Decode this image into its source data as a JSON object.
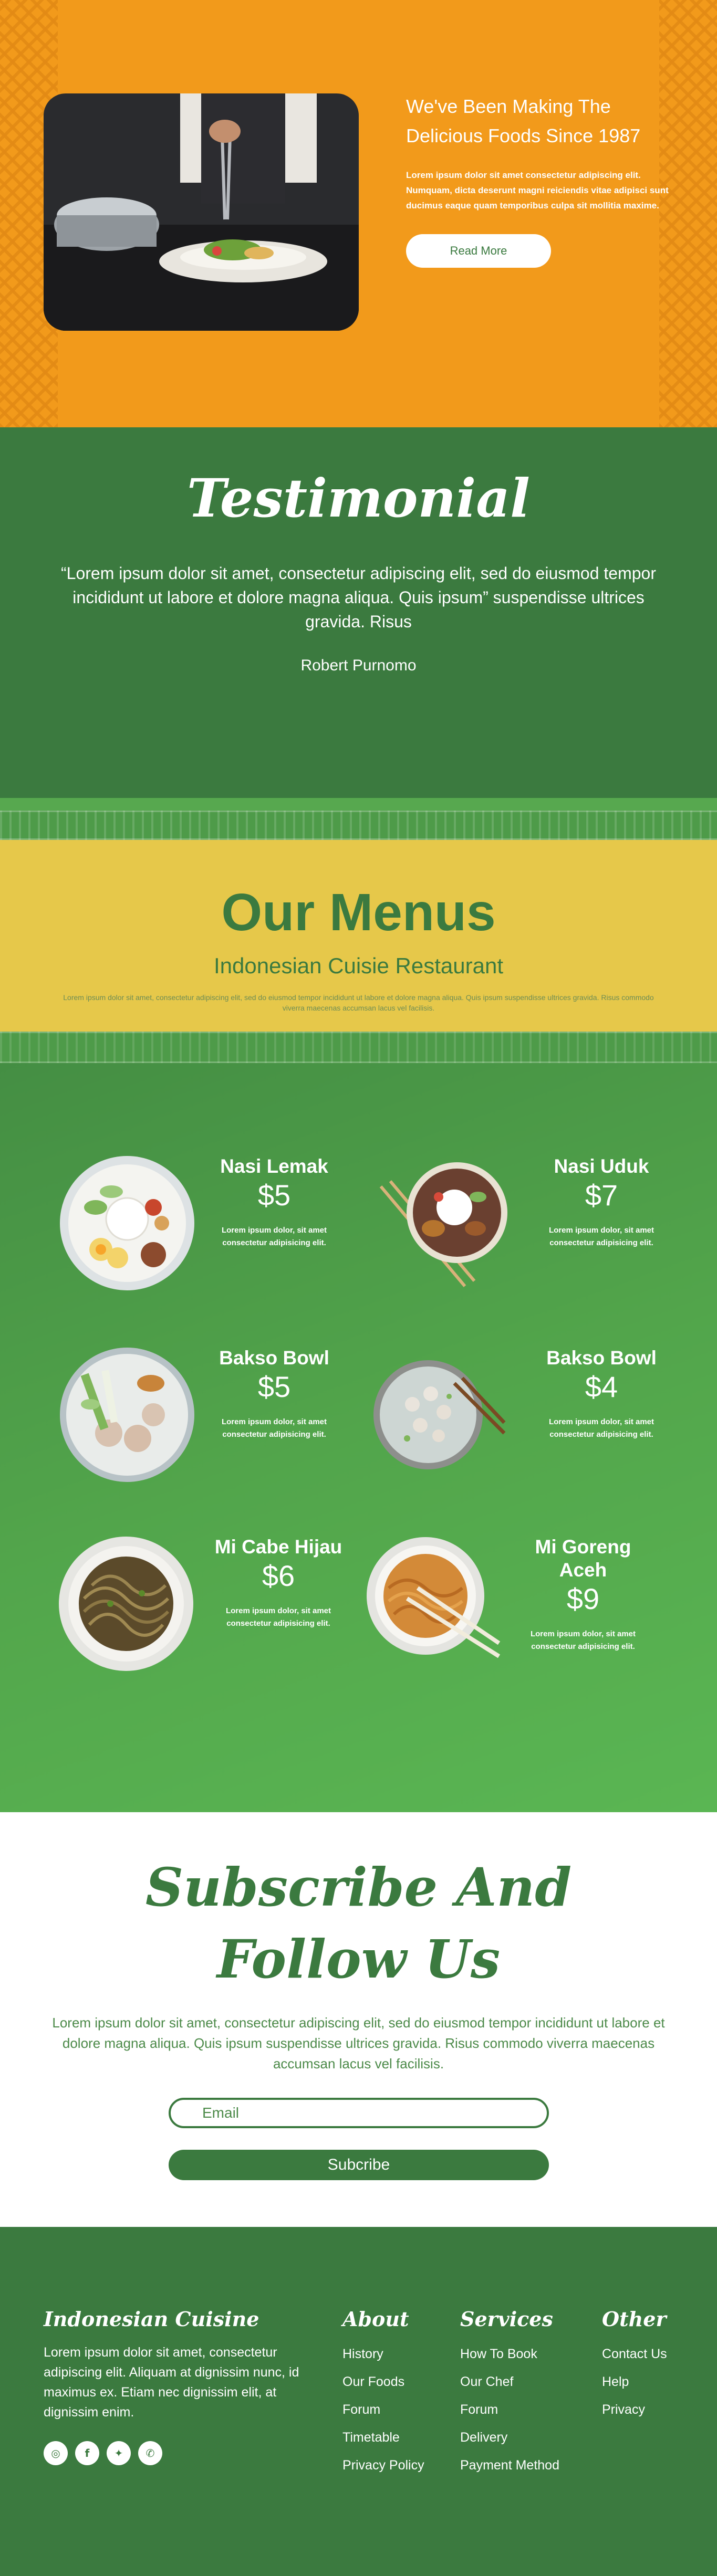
{
  "about": {
    "heading": "We've Been Making The Delicious Foods Since 1987",
    "body": "Lorem ipsum dolor sit amet consectetur adipiscing elit. Numquam, dicta deserunt magni reiciendis vitae adipisci sunt ducimus eaque quam temporibus culpa sit mollitia maxime.",
    "button_label": "Read More",
    "photo_icon": "chef-plating-photo"
  },
  "testimonial": {
    "title": "Testimonial",
    "quote": "“Lorem ipsum dolor sit amet, consectetur adipiscing elit, sed do eiusmod tempor incididunt ut labore et dolore magna aliqua. Quis ipsum” suspendisse ultrices gravida. Risus",
    "author": "Robert Purnomo"
  },
  "menus": {
    "title": "Our Menus",
    "subtitle": "Indonesian Cuisie Restaurant",
    "description": "Lorem ipsum dolor sit amet, consectetur adipiscing elit, sed do eiusmod tempor incididunt ut labore et dolore magna aliqua. Quis ipsum suspendisse ultrices gravida. Risus commodo viverra maecenas accumsan lacus vel facilisis.",
    "items": [
      {
        "name": "Nasi Lemak",
        "price": "$5",
        "desc": "Lorem ipsum dolor, sit amet consectetur adipisicing elit.",
        "icon": "nasi-lemak-plate"
      },
      {
        "name": "Nasi Uduk",
        "price": "$7",
        "desc": "Lorem ipsum dolor, sit amet consectetur adipisicing elit.",
        "icon": "nasi-uduk-bowl"
      },
      {
        "name": "Bakso Bowl",
        "price": "$5",
        "desc": "Lorem ipsum dolor, sit amet consectetur adipisicing elit.",
        "icon": "bakso-bowl"
      },
      {
        "name": "Bakso Bowl",
        "price": "$4",
        "desc": "Lorem ipsum dolor, sit amet consectetur adipisicing elit.",
        "icon": "bakso-soup-bowl"
      },
      {
        "name": "Mi Cabe Hijau",
        "price": "$6",
        "desc": "Lorem ipsum dolor, sit amet consectetur adipisicing elit.",
        "icon": "green-chili-noodle-plate"
      },
      {
        "name": "Mi Goreng Aceh",
        "price": "$9",
        "desc": "Lorem ipsum dolor, sit amet consectetur adipisicing elit.",
        "icon": "fried-noodle-plate"
      }
    ]
  },
  "subscribe": {
    "title_line1": "Subscribe And",
    "title_line2": "Follow Us",
    "body": "Lorem ipsum dolor sit amet, consectetur adipiscing elit, sed do eiusmod tempor incididunt ut labore et dolore magna aliqua. Quis ipsum suspendisse ultrices gravida. Risus commodo viverra maecenas accumsan lacus vel facilisis.",
    "email_placeholder": "Email",
    "button_label": "Subcribe"
  },
  "footer": {
    "brand_title": "Indonesian Cuisine",
    "brand_desc": "Lorem ipsum dolor sit amet, consectetur adipiscing elit. Aliquam at dignissim nunc, id maximus ex. Etiam nec dignissim elit, at dignissim enim.",
    "social": [
      {
        "icon": "instagram-icon",
        "glyph": "◎"
      },
      {
        "icon": "facebook-icon",
        "glyph": "f"
      },
      {
        "icon": "twitter-icon",
        "glyph": "✦"
      },
      {
        "icon": "whatsapp-icon",
        "glyph": "✆"
      }
    ],
    "columns": [
      {
        "title": "About",
        "links": [
          "History",
          "Our Foods",
          "Forum",
          "Timetable",
          "Privacy Policy"
        ]
      },
      {
        "title": "Services",
        "links": [
          "How To Book",
          "Our Chef",
          "Forum",
          "Delivery",
          "Payment Method"
        ]
      },
      {
        "title": "Other",
        "links": [
          "Contact Us",
          "Help",
          "Privacy"
        ]
      }
    ]
  },
  "colors": {
    "orange": "#f29a1b",
    "dark_green": "#3b7a3f",
    "light_green": "#57a84f",
    "yellow": "#e6c84a",
    "white": "#ffffff"
  }
}
